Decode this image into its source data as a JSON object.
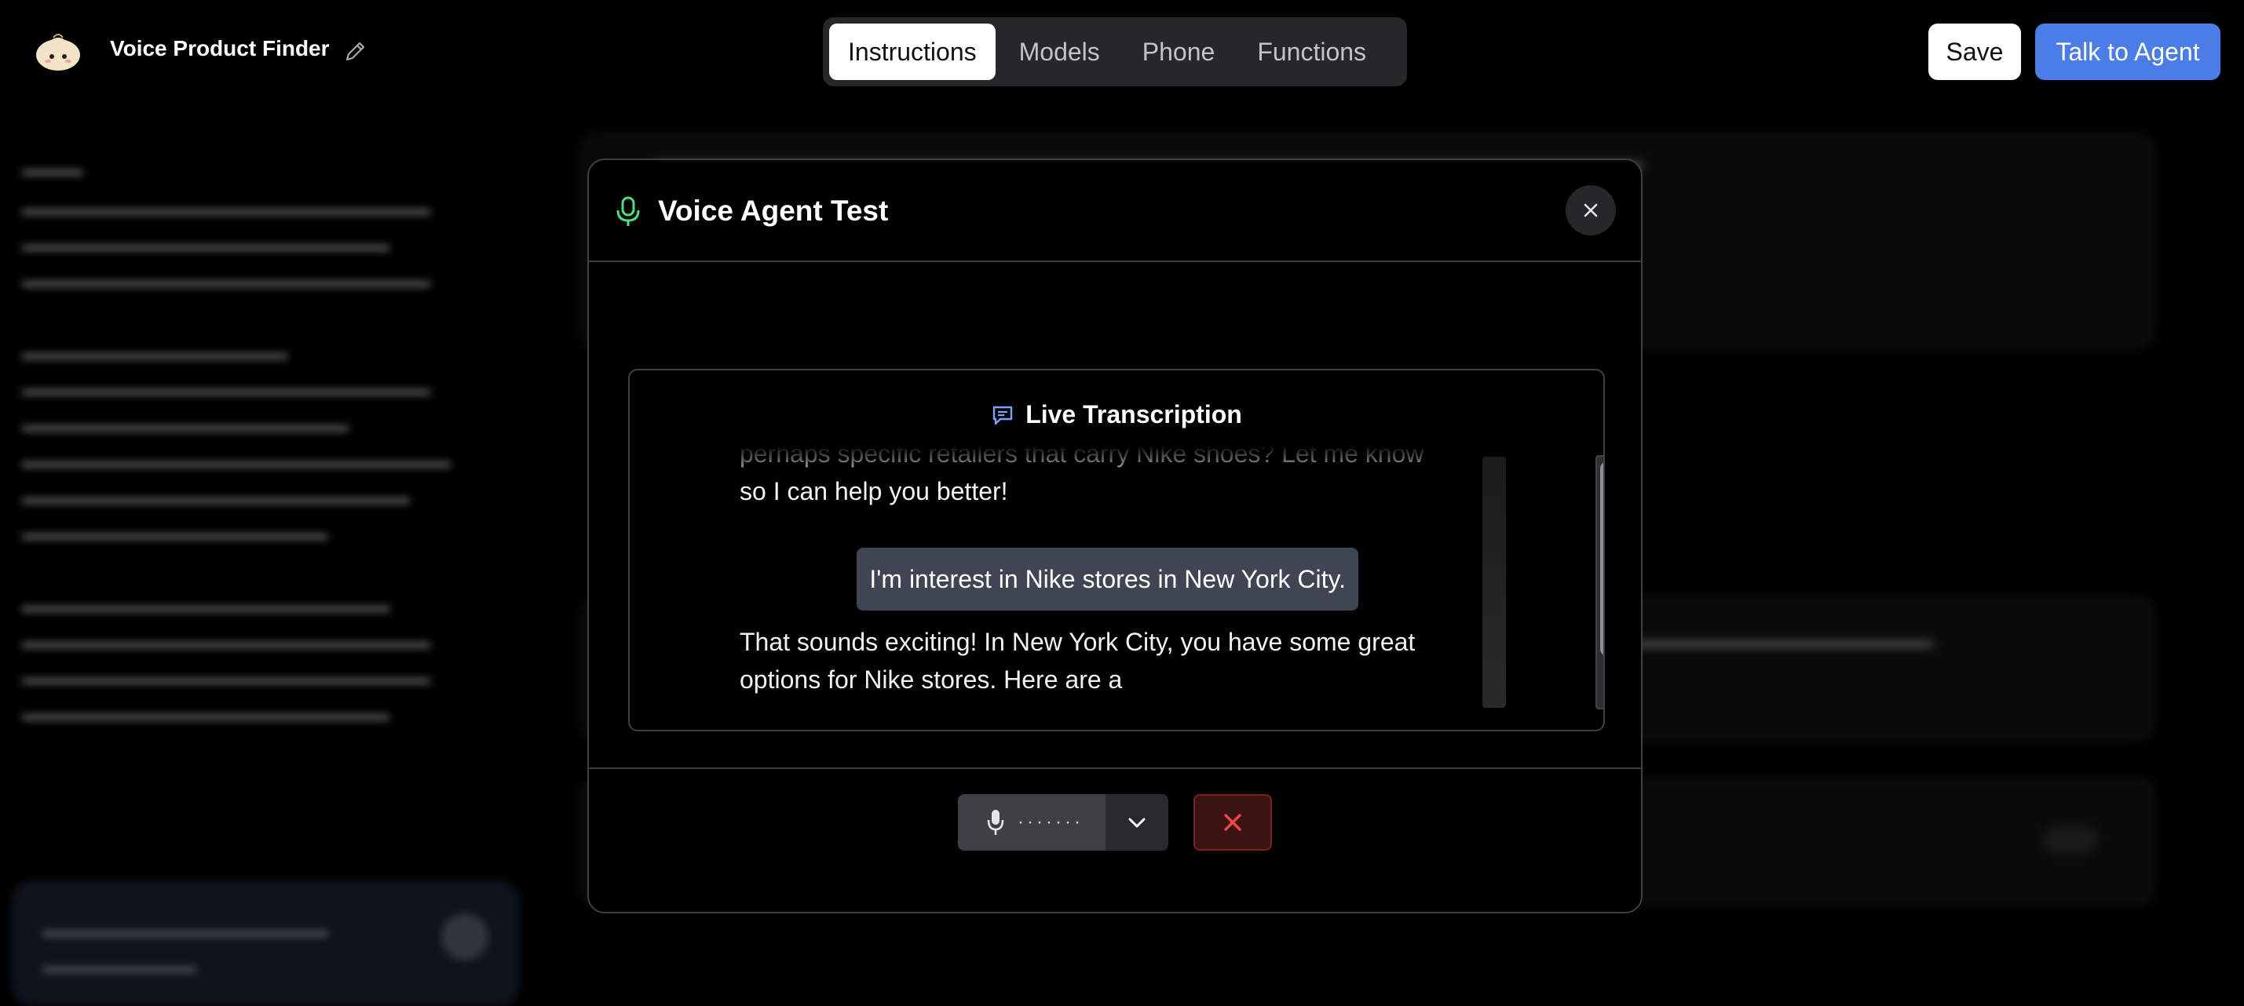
{
  "app": {
    "title": "Voice Product Finder",
    "tabs": [
      {
        "label": "Instructions",
        "active": true
      },
      {
        "label": "Models",
        "active": false
      },
      {
        "label": "Phone",
        "active": false
      },
      {
        "label": "Functions",
        "active": false
      }
    ],
    "save_label": "Save",
    "talk_label": "Talk to Agent",
    "accent_color": "#4a7de8"
  },
  "modal": {
    "title": "Voice Agent Test",
    "icon": "microphone-icon",
    "live_transcription_label": "Live Transcription",
    "messages": [
      {
        "role": "agent",
        "text": "perhaps specific retailers that carry Nike shoes? Let me know so I can help you better!"
      },
      {
        "role": "user",
        "text": "I'm interest in Nike stores in New York City."
      },
      {
        "role": "agent",
        "text": "That sounds exciting! In New York City, you have some great options for Nike stores. Here are a"
      }
    ],
    "mic_level_label": "·······",
    "end_call_icon": "close-icon"
  }
}
